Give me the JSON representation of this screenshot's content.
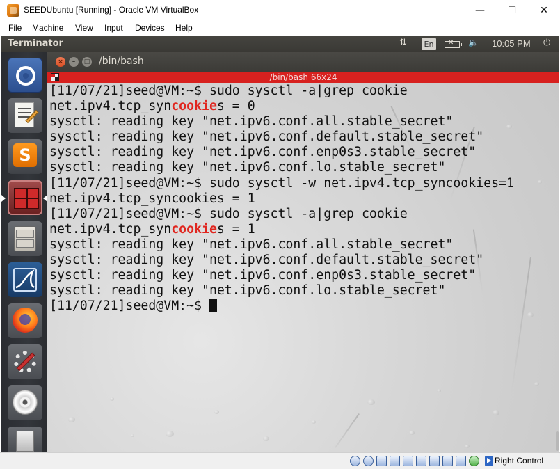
{
  "host_window": {
    "title": "SEEDUbuntu [Running] - Oracle VM VirtualBox",
    "minimize_glyph": "—",
    "maximize_glyph": "☐",
    "close_glyph": "✕"
  },
  "vbox_menu": [
    "File",
    "Machine",
    "View",
    "Input",
    "Devices",
    "Help"
  ],
  "ubuntu_panel": {
    "app_name": "Terminator",
    "keyboard_layout": "En",
    "time": "10:05 PM",
    "sort_icon_glyph": "⇅",
    "volume_glyph": "🔈",
    "power_glyph": "⏻"
  },
  "launcher": {
    "items": [
      "dash-home",
      "text-editor",
      "sublime-text",
      "terminator",
      "files",
      "wireshark",
      "firefox",
      "system-settings",
      "dvd-drive",
      "trash"
    ],
    "sublime_letter": "S"
  },
  "terminal_window": {
    "title": "/bin/bash",
    "tab_title": "/bin/bash 66x24",
    "close_glyph": "×",
    "min_glyph": "–",
    "max_glyph": "□"
  },
  "terminal": {
    "highlight_color": "#e0261f",
    "lines": [
      [
        {
          "t": "[11/07/21]seed@VM:~$ sudo sysctl -a|grep cookie"
        }
      ],
      [
        {
          "t": "net.ipv4.tcp_syn"
        },
        {
          "t": "cookie",
          "hl": true
        },
        {
          "t": "s = 0"
        }
      ],
      [
        {
          "t": "sysctl: reading key \"net.ipv6.conf.all.stable_secret\""
        }
      ],
      [
        {
          "t": "sysctl: reading key \"net.ipv6.conf.default.stable_secret\""
        }
      ],
      [
        {
          "t": "sysctl: reading key \"net.ipv6.conf.enp0s3.stable_secret\""
        }
      ],
      [
        {
          "t": "sysctl: reading key \"net.ipv6.conf.lo.stable_secret\""
        }
      ],
      [
        {
          "t": "[11/07/21]seed@VM:~$ sudo sysctl -w net.ipv4.tcp_syncookies=1"
        }
      ],
      [
        {
          "t": "net.ipv4.tcp_syncookies = 1"
        }
      ],
      [
        {
          "t": "[11/07/21]seed@VM:~$ sudo sysctl -a|grep cookie"
        }
      ],
      [
        {
          "t": "net.ipv4.tcp_syn"
        },
        {
          "t": "cookie",
          "hl": true
        },
        {
          "t": "s = 1"
        }
      ],
      [
        {
          "t": "sysctl: reading key \"net.ipv6.conf.all.stable_secret\""
        }
      ],
      [
        {
          "t": "sysctl: reading key \"net.ipv6.conf.default.stable_secret\""
        }
      ],
      [
        {
          "t": "sysctl: reading key \"net.ipv6.conf.enp0s3.stable_secret\""
        }
      ],
      [
        {
          "t": "sysctl: reading key \"net.ipv6.conf.lo.stable_secret\""
        }
      ],
      [
        {
          "t": "[11/07/21]seed@VM:~$ "
        }
      ]
    ]
  },
  "status_bar": {
    "host_key_label": "Right Control"
  }
}
